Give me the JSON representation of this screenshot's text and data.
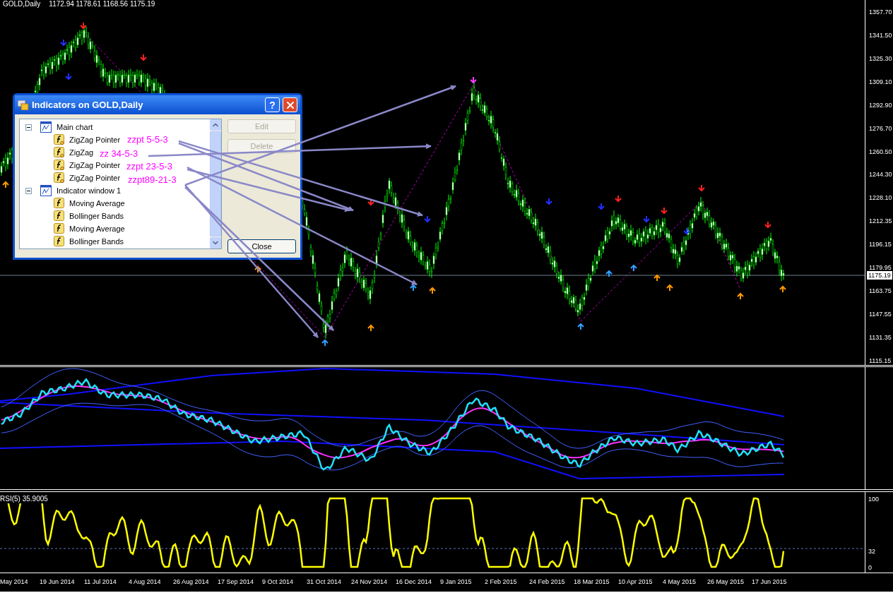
{
  "chart": {
    "symbol": "GOLD,Daily",
    "ohlc": "1172.94 1178.61 1168.56 1175.19",
    "current_price": "1175.19",
    "price_axis": [
      "1357.70",
      "1341.50",
      "1325.30",
      "1309.10",
      "1292.90",
      "1276.70",
      "1260.50",
      "1244.30",
      "1228.10",
      "1212.35",
      "1196.15",
      "1179.95",
      "1163.75",
      "1147.55",
      "1131.35",
      "1115.15"
    ]
  },
  "dialog": {
    "title": "Indicators on GOLD,Daily",
    "help_button": "?",
    "tree": [
      {
        "label": "Main chart",
        "expanded": true,
        "children": [
          {
            "label": "ZigZag Pointer",
            "kind": "custom"
          },
          {
            "label": "ZigZag",
            "kind": "custom"
          },
          {
            "label": "ZigZag Pointer",
            "kind": "custom"
          },
          {
            "label": "ZigZag Pointer",
            "kind": "custom"
          }
        ]
      },
      {
        "label": "Indicator window 1",
        "expanded": true,
        "children": [
          {
            "label": "Moving Average",
            "kind": "builtin"
          },
          {
            "label": "Bollinger Bands",
            "kind": "builtin"
          },
          {
            "label": "Moving Average",
            "kind": "builtin"
          },
          {
            "label": "Bollinger Bands",
            "kind": "builtin"
          }
        ]
      }
    ],
    "buttons": [
      {
        "label": "Edit",
        "disabled": true
      },
      {
        "label": "Delete",
        "disabled": true
      },
      {
        "label": "Close",
        "disabled": false
      }
    ]
  },
  "annotations": [
    {
      "text": "zzpt 5-5-3"
    },
    {
      "text": "zz 34-5-3"
    },
    {
      "text": "zzpt 23-5-3"
    },
    {
      "text": "zzpt89-21-3"
    }
  ],
  "rsi": {
    "label": "RSI(5) 35.9005",
    "axis": [
      "100",
      "32",
      "0"
    ]
  },
  "date_axis": [
    "May 2014",
    "19 Jun 2014",
    "11 Jul 2014",
    "4 Aug 2014",
    "26 Aug 2014",
    "17 Sep 2014",
    "9 Oct 2014",
    "31 Oct 2014",
    "24 Nov 2014",
    "16 Dec 2014",
    "9 Jan 2015",
    "2 Feb 2015",
    "24 Feb 2015",
    "18 Mar 2015",
    "10 Apr 2015",
    "4 May 2015",
    "26 May 2015",
    "17 Jun 2015"
  ]
}
